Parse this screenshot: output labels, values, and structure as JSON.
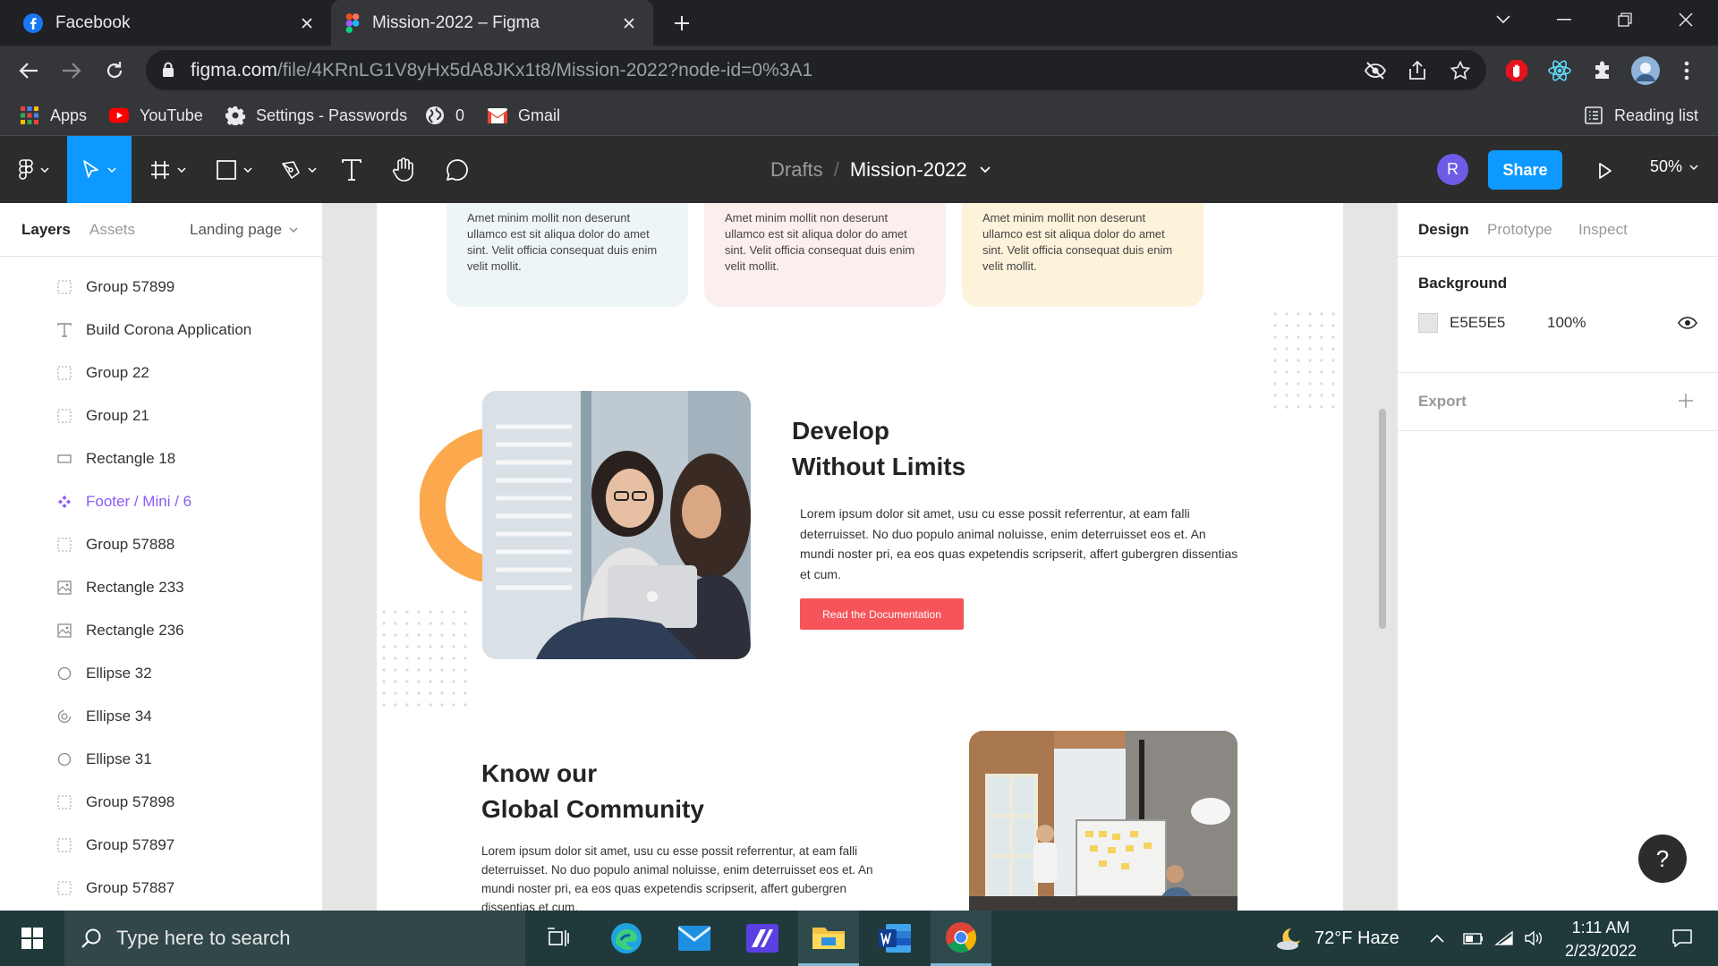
{
  "browser": {
    "tabs": [
      {
        "title": "Facebook",
        "active": false
      },
      {
        "title": "Mission-2022 – Figma",
        "active": true
      }
    ],
    "url": {
      "host": "figma.com",
      "path": "/file/4KRnLG1V8yHx5dA8JKx1t8/Mission-2022?node-id=0%3A1"
    },
    "bookmarks": [
      {
        "label": "Apps",
        "icon": "apps-grid-icon"
      },
      {
        "label": "YouTube",
        "icon": "youtube-icon"
      },
      {
        "label": "Settings - Passwords",
        "icon": "gear-icon"
      },
      {
        "label": "0",
        "icon": "globe-icon"
      },
      {
        "label": "Gmail",
        "icon": "gmail-icon"
      }
    ],
    "reading_list": "Reading list"
  },
  "figma": {
    "breadcrumb": {
      "parent": "Drafts",
      "separator": "/",
      "file": "Mission-2022"
    },
    "avatar_initial": "R",
    "share_label": "Share",
    "zoom": "50%",
    "left_panel": {
      "tabs": {
        "layers": "Layers",
        "assets": "Assets",
        "page": "Landing page"
      },
      "layers": [
        {
          "label": "Group 57899",
          "icon": "group-icon"
        },
        {
          "label": "Build Corona Application",
          "icon": "text-icon"
        },
        {
          "label": "Group 22",
          "icon": "group-icon"
        },
        {
          "label": "Group 21",
          "icon": "group-icon"
        },
        {
          "label": "Rectangle 18",
          "icon": "rectangle-icon"
        },
        {
          "label": "Footer / Mini / 6",
          "icon": "component-icon"
        },
        {
          "label": "Group 57888",
          "icon": "group-icon"
        },
        {
          "label": "Rectangle 233",
          "icon": "image-icon"
        },
        {
          "label": "Rectangle 236",
          "icon": "image-icon"
        },
        {
          "label": "Ellipse 32",
          "icon": "ellipse-icon"
        },
        {
          "label": "Ellipse 34",
          "icon": "arc-icon"
        },
        {
          "label": "Ellipse 31",
          "icon": "ellipse-icon"
        },
        {
          "label": "Group 57898",
          "icon": "group-icon"
        },
        {
          "label": "Group 57897",
          "icon": "group-icon"
        },
        {
          "label": "Group 57887",
          "icon": "group-icon"
        }
      ]
    },
    "canvas": {
      "cards": [
        {
          "text": "Amet minim mollit non deserunt ullamco est sit aliqua dolor do amet sint. Velit officia consequat duis enim velit mollit.",
          "color": "#eef5f7"
        },
        {
          "text": "Amet minim mollit non deserunt ullamco est sit aliqua dolor do amet sint. Velit officia consequat duis enim velit mollit.",
          "color": "#fdeeee"
        },
        {
          "text": "Amet minim mollit non deserunt ullamco est sit aliqua dolor do amet sint. Velit officia consequat duis enim velit mollit.",
          "color": "#fdf3da"
        }
      ],
      "develop": {
        "title_line1": "Develop",
        "title_line2": "Without Limits",
        "body": "Lorem ipsum dolor sit amet, usu cu esse possit referrentur, at eam falli deterruisset. No duo populo animal noluisse, enim deterruisset eos et. An mundi noster pri, ea eos quas expetendis scripserit, affert gubergren dissentias et cum.",
        "button": "Read the  Documentation"
      },
      "community": {
        "title_line1": "Know our",
        "title_line2": "Global Community",
        "body": "Lorem ipsum dolor sit amet, usu cu esse possit referrentur, at eam falli deterruisset. No duo populo animal noluisse, enim deterruisset eos et. An mundi noster pri, ea eos quas expetendis scripserit, affert gubergren dissentias et cum."
      },
      "accent_orange": "#fba94c",
      "accent_red": "#f5545a"
    },
    "right_panel": {
      "tabs": {
        "design": "Design",
        "prototype": "Prototype",
        "inspect": "Inspect"
      },
      "background_title": "Background",
      "background_hex": "E5E5E5",
      "background_opacity": "100%",
      "export_title": "Export"
    },
    "help": "?"
  },
  "taskbar": {
    "search_placeholder": "Type here to search",
    "weather": "72°F  Haze",
    "time": "1:11 AM",
    "date": "2/23/2022"
  }
}
